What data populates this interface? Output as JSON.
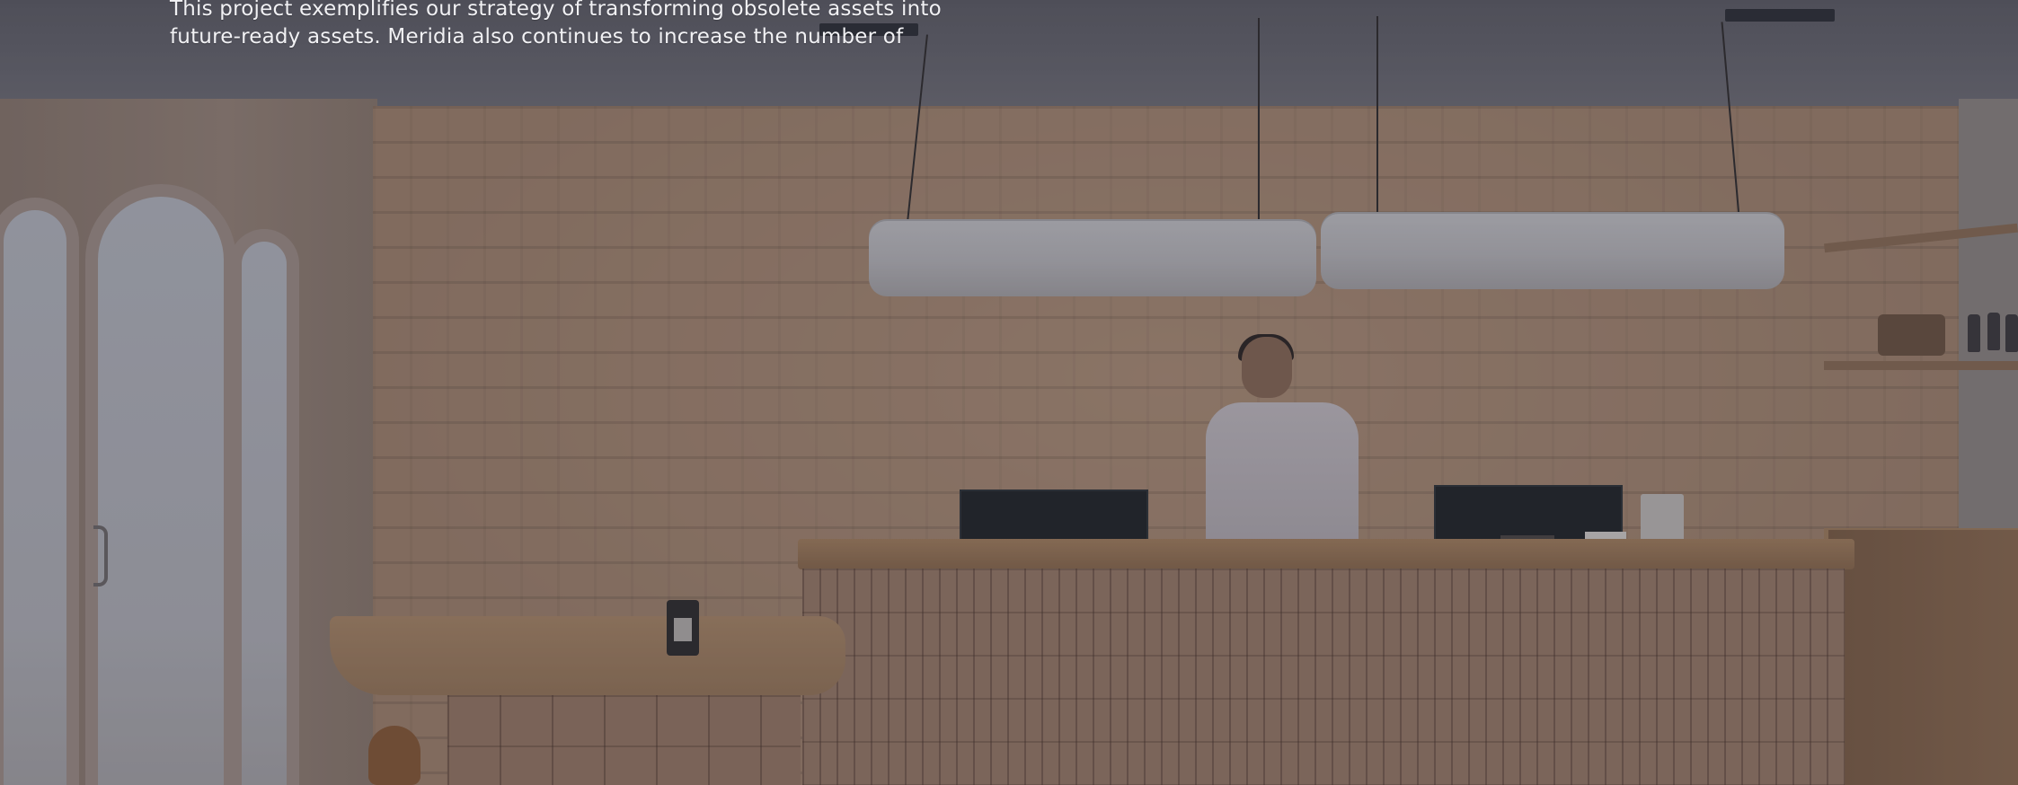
{
  "hero": {
    "caption_lines": [
      "This project exemplifies our strategy of transforming obsolete assets into",
      "future-ready assets. Meridia also continues to increase the number of"
    ]
  },
  "colors": {
    "overlay": "#282837",
    "brick": "#a98a72",
    "wood": "#9b7a5a",
    "caption_text": "#f1f1f4"
  }
}
